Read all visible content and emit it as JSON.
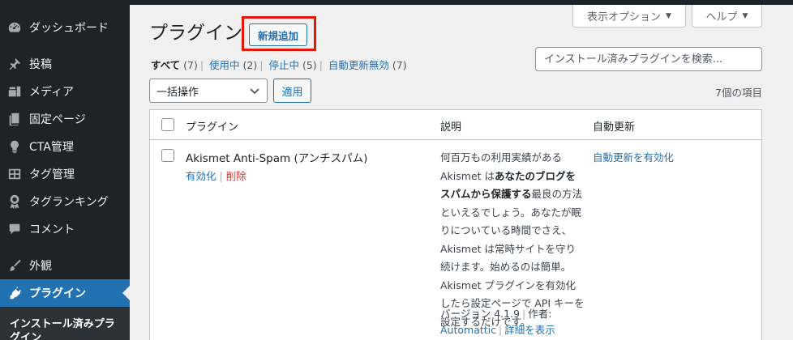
{
  "sidebar": {
    "items": [
      {
        "label": "ダッシュボード",
        "icon": "dashboard-icon"
      },
      {
        "label": "投稿",
        "icon": "pin-icon"
      },
      {
        "label": "メディア",
        "icon": "media-icon"
      },
      {
        "label": "固定ページ",
        "icon": "page-icon"
      },
      {
        "label": "CTA管理",
        "icon": "lightbulb-icon"
      },
      {
        "label": "タグ管理",
        "icon": "grid-icon"
      },
      {
        "label": "タグランキング",
        "icon": "award-icon"
      },
      {
        "label": "コメント",
        "icon": "comment-icon"
      },
      {
        "label": "外観",
        "icon": "brush-icon"
      },
      {
        "label": "プラグイン",
        "icon": "plugin-icon"
      }
    ],
    "submenu_item": "インストール済みプラグイン"
  },
  "screen_options": {
    "label": "表示オプション"
  },
  "help": {
    "label": "ヘルプ"
  },
  "page": {
    "title": "プラグイン",
    "add_new": "新規追加"
  },
  "filters": [
    {
      "label": "すべて",
      "count": "(7)"
    },
    {
      "label": "使用中",
      "count": "(2)"
    },
    {
      "label": "停止中",
      "count": "(5)"
    },
    {
      "label": "自動更新無効",
      "count": "(7)"
    }
  ],
  "search": {
    "placeholder": "インストール済みプラグインを検索..."
  },
  "bulk": {
    "selected": "一括操作",
    "apply": "適用"
  },
  "item_count": "7個の項目",
  "table": {
    "headers": {
      "plugin": "プラグイン",
      "description": "説明",
      "auto_update": "自動更新"
    },
    "rows": [
      {
        "name": "Akismet Anti-Spam (アンチスパム)",
        "actions": {
          "activate": "有効化",
          "delete": "削除"
        },
        "description": {
          "t1": "何百万もの利用実績がある Akismet は",
          "b1": "あなたのブログをスパムから保護する",
          "t2": "最良の方法といえるでしょう。あなたが眠りについている時間でさえ、Akismet は常時サイトを守り続けます。始めるのは簡単。Akismet プラグインを有効化したら設定ページで API キーを設定するだけです。"
        },
        "version": "バージョン 4.1.9",
        "author_prefix": "作者:",
        "author": "Automattic",
        "details": "詳細を表示",
        "auto_update": "自動更新を有効化"
      }
    ]
  },
  "colors": {
    "sidebar": "#1d2327",
    "accent": "#2271b1",
    "highlight": "#e3170a",
    "delete": "#d63638"
  }
}
